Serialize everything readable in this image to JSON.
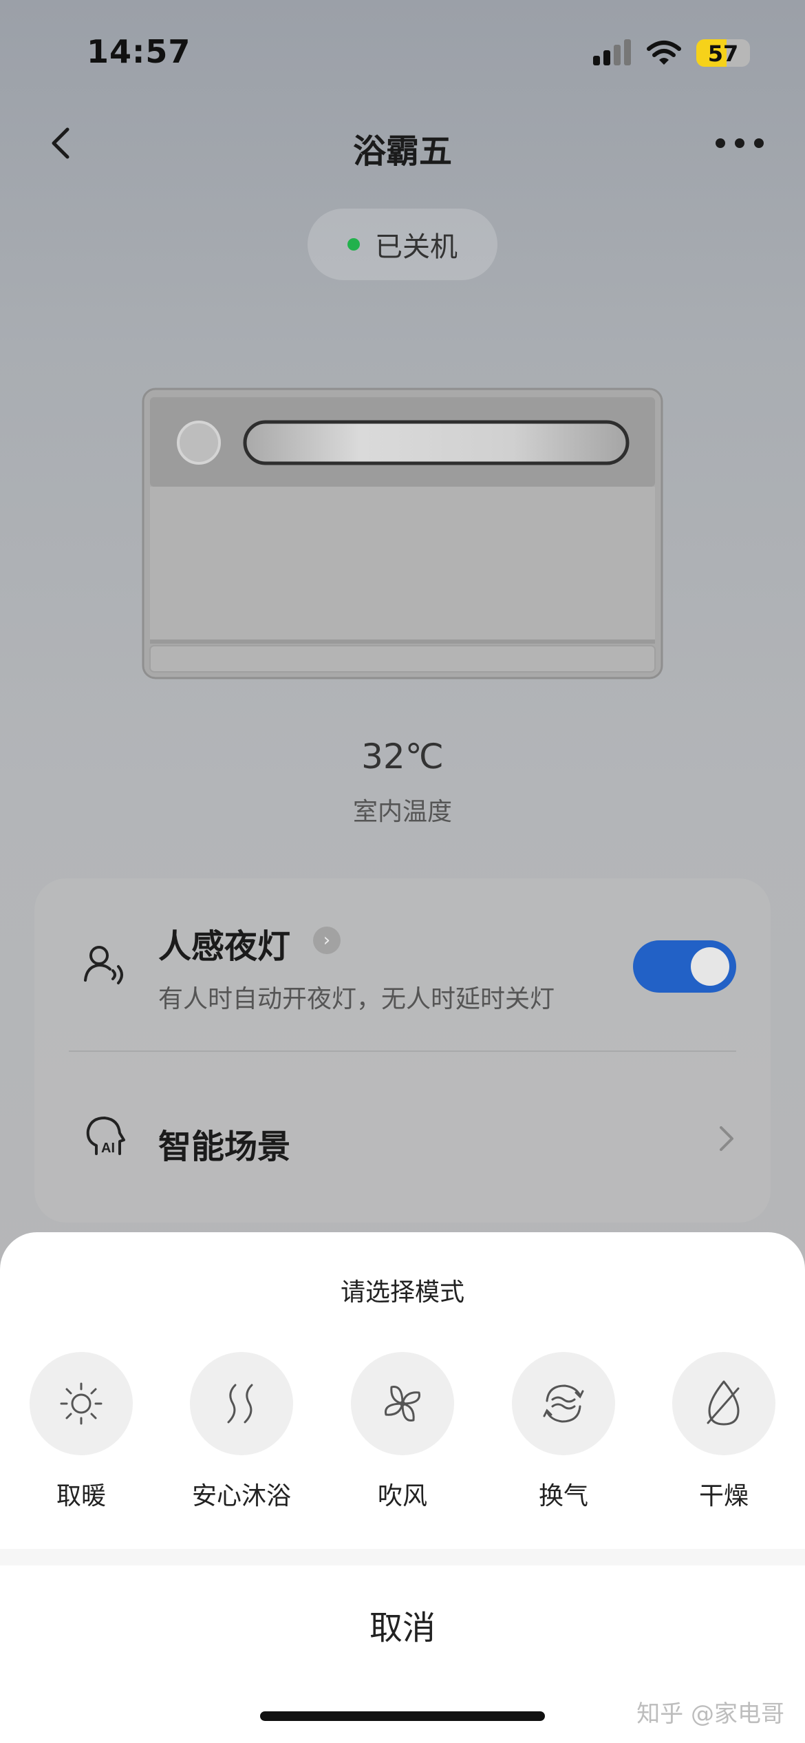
{
  "status_bar": {
    "time": "14:57",
    "battery": "57"
  },
  "header": {
    "title": "浴霸五"
  },
  "device_status": {
    "text": "已关机",
    "indicator_color": "#22b14c"
  },
  "temperature": {
    "value": "32℃",
    "label": "室内温度"
  },
  "card": {
    "night_light": {
      "title": "人感夜灯",
      "subtitle": "有人时自动开夜灯，无人时延时关灯",
      "enabled": true
    },
    "scene": {
      "title": "智能场景"
    }
  },
  "sheet": {
    "title": "请选择模式",
    "modes": [
      {
        "label": "取暖",
        "icon": "sun-icon"
      },
      {
        "label": "安心沐浴",
        "icon": "steam-icon"
      },
      {
        "label": "吹风",
        "icon": "fan-icon"
      },
      {
        "label": "换气",
        "icon": "ventilation-icon"
      },
      {
        "label": "干燥",
        "icon": "dry-drop-icon"
      }
    ],
    "cancel": "取消"
  },
  "watermark": "知乎 @家电哥",
  "colors": {
    "toggle_on": "#2261c6"
  }
}
